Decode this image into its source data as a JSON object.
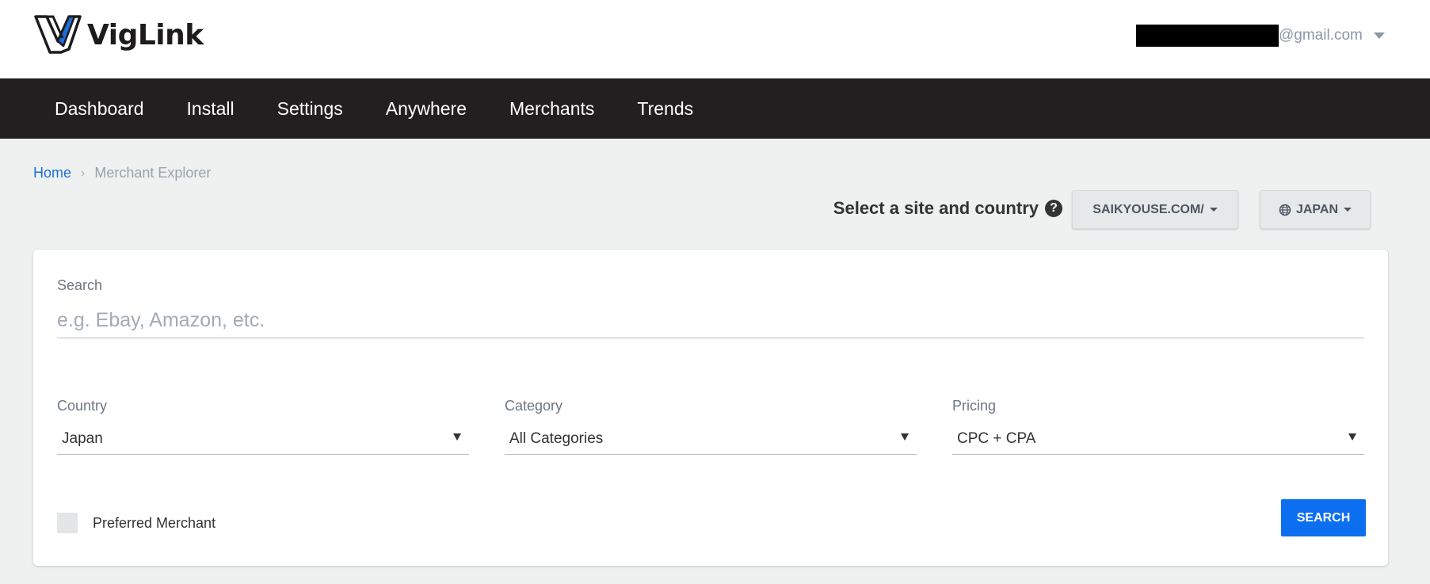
{
  "header": {
    "logo_text": "VigLink",
    "account_email_suffix": "@gmail.com",
    "colors": {
      "brand_dark": "#1d1b1c",
      "brand_blue": "#1c6fd8"
    }
  },
  "nav": {
    "items": [
      "Dashboard",
      "Install",
      "Settings",
      "Anywhere",
      "Merchants",
      "Trends"
    ]
  },
  "breadcrumb": {
    "home": "Home",
    "separator": "›",
    "current": "Merchant Explorer"
  },
  "site_selector": {
    "label": "Select a site and country",
    "site_value": "SAIKYOUSE.COM/",
    "country_value": "JAPAN"
  },
  "search": {
    "label": "Search",
    "placeholder": "e.g. Ebay, Amazon, etc.",
    "value": ""
  },
  "filters": {
    "country": {
      "label": "Country",
      "value": "Japan"
    },
    "category": {
      "label": "Category",
      "value": "All Categories"
    },
    "pricing": {
      "label": "Pricing",
      "value": "CPC + CPA"
    }
  },
  "preferred": {
    "label": "Preferred Merchant",
    "checked": false
  },
  "search_button": {
    "label": "SEARCH",
    "color": "#0b6ff0"
  }
}
